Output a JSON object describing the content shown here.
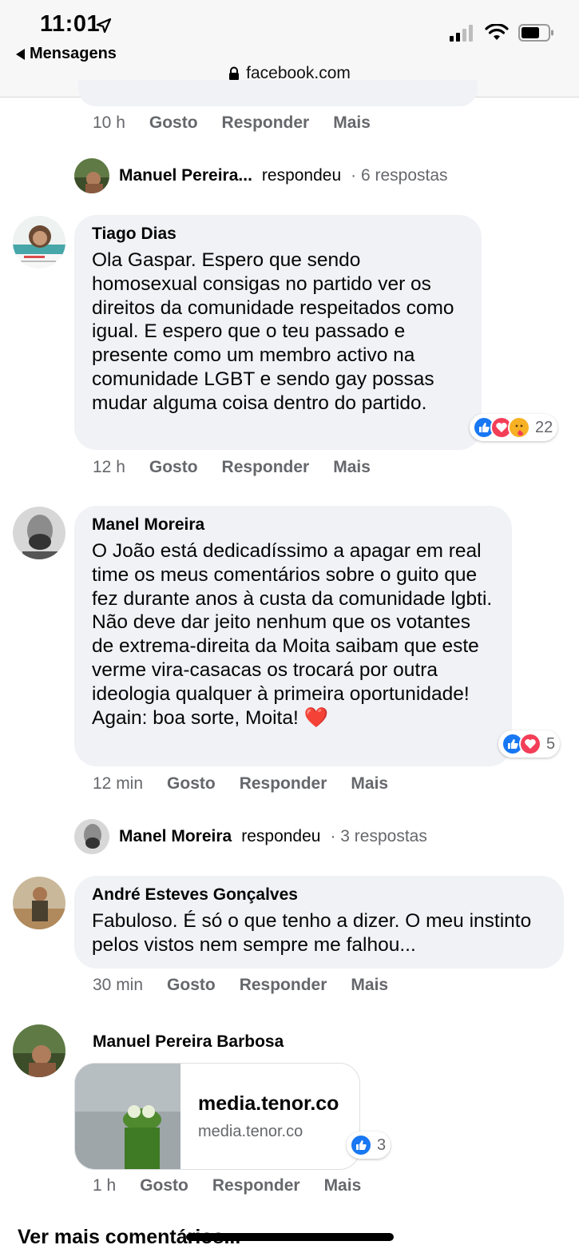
{
  "status": {
    "time": "11:01",
    "back_label": "Mensagens",
    "url": "facebook.com"
  },
  "top_actions": {
    "time": "10 h",
    "like": "Gosto",
    "reply": "Responder",
    "more": "Mais"
  },
  "reply_summary_1": {
    "name": "Manuel Pereira...",
    "verb": "respondeu",
    "count": "· 6 respostas"
  },
  "comments": [
    {
      "author": "Tiago Dias",
      "text": "Ola Gaspar. Espero que sendo homosexual consigas no partido ver os direitos da comunidade respeitados como igual. E espero que o teu passado e presente como um membro activo na comunidade LGBT e sendo gay possas mudar alguma coisa dentro do partido.",
      "reactions": "22",
      "time": "12 h",
      "like": "Gosto",
      "reply": "Responder",
      "more": "Mais"
    },
    {
      "author": "Manel Moreira",
      "text": "O João está dedicadíssimo a apagar em real time os meus comentários sobre o guito que fez durante anos à custa da comunidade lgbti. Não deve dar jeito nenhum que os votantes de extrema-direita da Moita saibam que este verme vira-casacas os trocará por outra ideologia qualquer à primeira oportunidade! Again: boa sorte, Moita! ❤️",
      "reactions": "5",
      "time": "12 min",
      "like": "Gosto",
      "reply": "Responder",
      "more": "Mais"
    },
    {
      "author": "André Esteves Gonçalves",
      "text": "Fabuloso. É só o que tenho a dizer. O meu instinto pelos vistos nem sempre me falhou...",
      "time": "30 min",
      "like": "Gosto",
      "reply": "Responder",
      "more": "Mais"
    },
    {
      "author": "Manuel Pereira Barbosa",
      "link_title": "media.tenor.co",
      "link_domain": "media.tenor.co",
      "reactions": "3",
      "time": "1 h",
      "like": "Gosto",
      "reply": "Responder",
      "more": "Mais"
    }
  ],
  "reply_summary_2": {
    "name": "Manel Moreira",
    "verb": "respondeu",
    "count": "· 3 respostas"
  },
  "view_more": "Ver mais comentários..."
}
